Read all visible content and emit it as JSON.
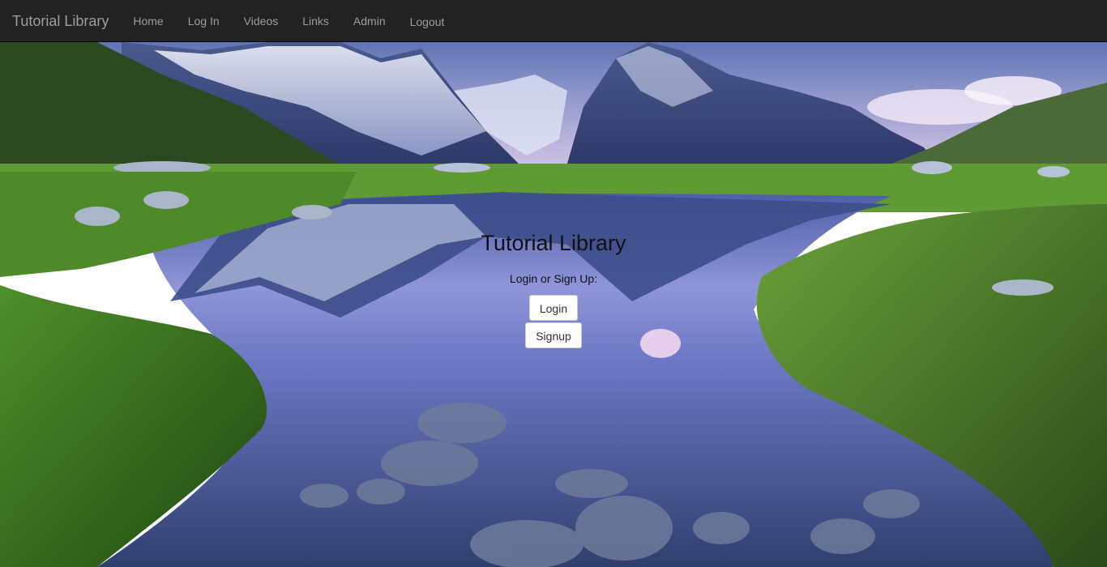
{
  "navbar": {
    "brand": "Tutorial Library",
    "items": [
      {
        "label": "Home"
      },
      {
        "label": "Log In"
      },
      {
        "label": "Videos"
      },
      {
        "label": "Links"
      },
      {
        "label": "Admin"
      },
      {
        "label": "Logout"
      }
    ]
  },
  "main": {
    "title": "Tutorial Library",
    "subtitle": "Login or Sign Up:",
    "login_label": "Login",
    "signup_label": "Signup"
  },
  "colors": {
    "navbar_bg": "#222222",
    "nav_text": "#9d9d9d",
    "button_bg": "#ffffff",
    "button_border": "#cccccc"
  }
}
